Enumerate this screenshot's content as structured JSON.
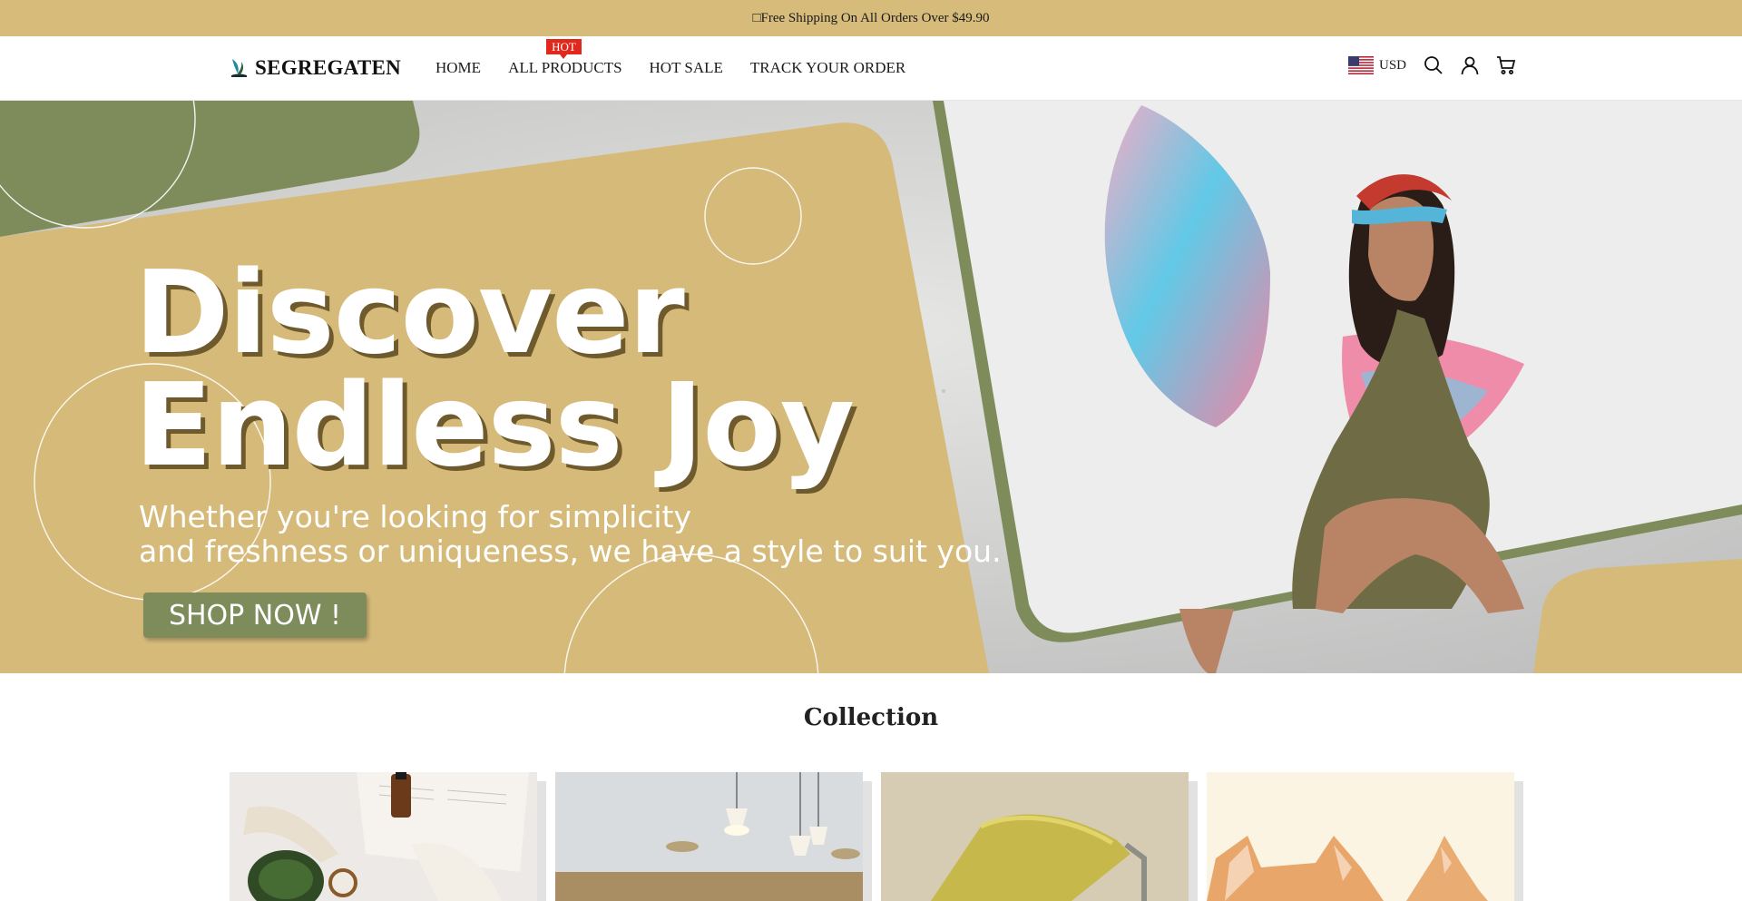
{
  "announcement": {
    "text": "□Free Shipping On All Orders Over $49.90"
  },
  "header": {
    "logo_text": "SEGREGATEN",
    "nav": [
      {
        "label": "HOME"
      },
      {
        "label": "ALL PRODUCTS",
        "badge": "HOT"
      },
      {
        "label": "HOT SALE"
      },
      {
        "label": "TRACK YOUR ORDER"
      }
    ],
    "currency": "USD",
    "icons": [
      "us-flag-icon",
      "search-icon",
      "account-icon",
      "cart-icon"
    ]
  },
  "hero": {
    "title_line1": "Discover",
    "title_line2": "Endless Joy",
    "subtitle_line1": "Whether you're looking for simplicity",
    "subtitle_line2": "and freshness or uniqueness, we have a style to suit you.",
    "button": "SHOP NOW !"
  },
  "collection": {
    "title": "Collection",
    "cards": [
      {
        "image": "lifestyle-flatlay-image"
      },
      {
        "image": "pendant-lights-image"
      },
      {
        "image": "paint-roller-image"
      },
      {
        "image": "kitten-image"
      }
    ]
  },
  "colors": {
    "announcement_bg": "#d7bb7b",
    "accent_green": "#7d8c5a",
    "hot_badge": "#e0281c",
    "hero_tan": "#d6ba7a"
  }
}
